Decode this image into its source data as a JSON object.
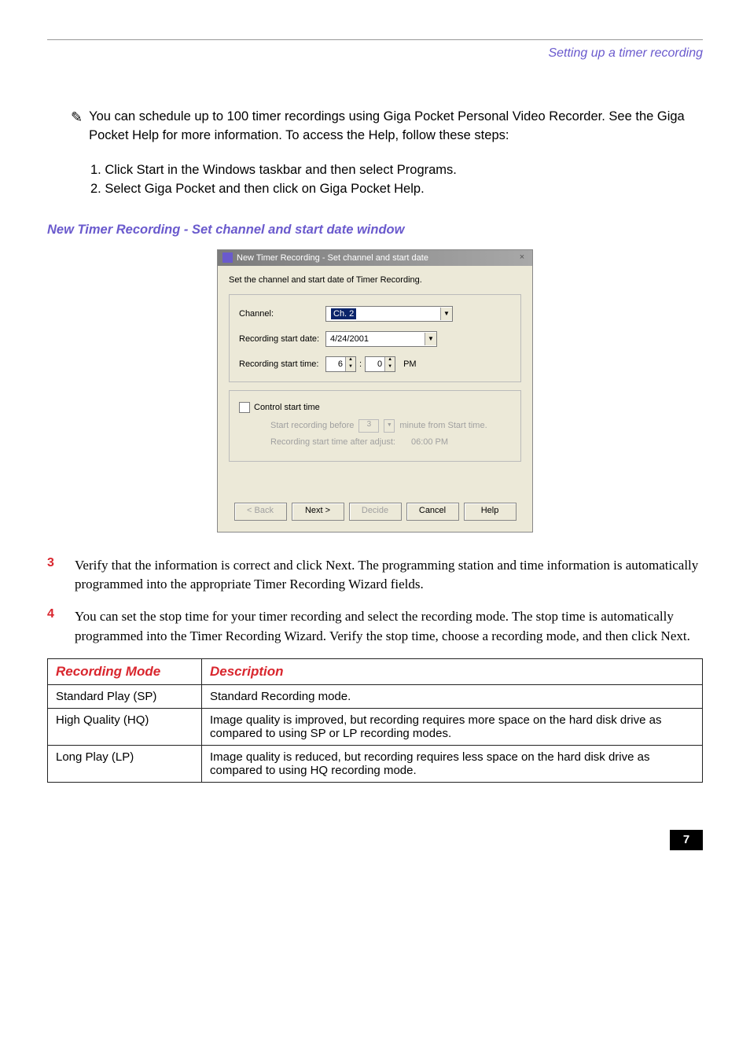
{
  "header": {
    "breadcrumb": "Setting up a timer recording"
  },
  "note": {
    "text": "You can schedule up to 100 timer recordings using Giga Pocket Personal Video Recorder. See the Giga Pocket Help for more information. To access the Help, follow these steps:",
    "step1": "1. Click Start in the Windows taskbar and then select Programs.",
    "step2": "2. Select Giga Pocket and then click on Giga Pocket Help."
  },
  "section_heading": "New Timer Recording - Set channel and start date window",
  "dialog": {
    "title": "New Timer Recording - Set channel and start date",
    "instruction": "Set the channel and start date of Timer Recording.",
    "channel_label": "Channel:",
    "channel_value": "Ch. 2",
    "start_date_label": "Recording start date:",
    "start_date_value": "4/24/2001",
    "start_time_label": "Recording start time:",
    "start_time_hour": "6",
    "start_time_min": "0",
    "start_time_ampm": "PM",
    "control_start_label": "Control start time",
    "start_before_label": "Start recording before",
    "start_before_value": "3",
    "start_before_suffix": "minute from Start time.",
    "after_adjust_label": "Recording start time after adjust:",
    "after_adjust_value": "06:00 PM",
    "btn_back": "< Back",
    "btn_next": "Next >",
    "btn_decide": "Decide",
    "btn_cancel": "Cancel",
    "btn_help": "Help"
  },
  "steps": {
    "s3": "Verify that the information is correct and click Next. The programming station and time information is automatically programmed into the appropriate Timer Recording Wizard fields.",
    "s4": "You can set the stop time for your timer recording and select the recording mode. The stop time is automatically programmed into the Timer Recording Wizard. Verify the stop time, choose a recording mode, and then click Next."
  },
  "table": {
    "h1": "Recording Mode",
    "h2": "Description",
    "rows": [
      {
        "mode": "Standard Play (SP)",
        "desc": "Standard Recording mode."
      },
      {
        "mode": "High Quality (HQ)",
        "desc": "Image quality is improved, but recording requires more space on the hard disk drive as compared to using SP or LP recording modes."
      },
      {
        "mode": "Long Play (LP)",
        "desc": "Image quality is reduced, but recording requires less space on the hard disk drive as compared to using HQ recording mode."
      }
    ]
  },
  "page_number": "7"
}
